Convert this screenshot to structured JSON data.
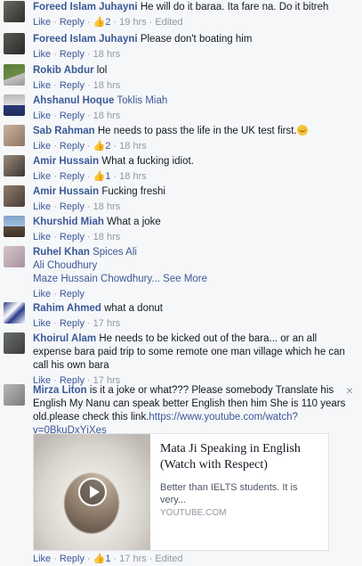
{
  "actions": {
    "like": "Like",
    "reply": "Reply",
    "edited": "Edited",
    "see_more": "See More",
    "thumb": "👍"
  },
  "comments": [
    {
      "name": "Foreed Islam Juhayni",
      "text": "He will do it baraa. Ita fare na. Do it bitreh",
      "likes": "2",
      "time": "19 hrs",
      "edited": true
    },
    {
      "name": "Foreed Islam Juhayni",
      "text": "Please don't boating him",
      "time": "18 hrs"
    },
    {
      "name": "Rokib Abdur",
      "text": "lol",
      "time": "18 hrs"
    },
    {
      "name": "Ahshanul Hoque",
      "text": "Toklis Miah",
      "time": "18 hrs",
      "text_is_link": true
    },
    {
      "name": "Sab Rahman",
      "text": "He needs to pass the life in the UK test first.",
      "likes": "2",
      "time": "18 hrs",
      "emoji": true
    },
    {
      "name": "Amir Hussain",
      "text": "What a fucking idiot.",
      "likes": "1",
      "time": "18 hrs"
    },
    {
      "name": "Amir Hussain",
      "text": "Fucking freshi",
      "time": "18 hrs"
    },
    {
      "name": "Khurshid Miah",
      "text": "What a joke",
      "time": "18 hrs"
    },
    {
      "name": "Ruhel Khan",
      "text": "Spices Ali",
      "text_is_link": true,
      "line2": "Ali Choudhury",
      "line3": "Maze Hussain Chowdhury...",
      "time": ""
    },
    {
      "name": "Rahim Ahmed",
      "text": "what a donut",
      "time": "17 hrs"
    },
    {
      "name": "Khoirul Alam",
      "text": "He needs to be kicked out of the bara... or an all expense bara paid trip to some remote one man village which he can call his own bara",
      "time": "17 hrs"
    },
    {
      "name": "Mirza Liton",
      "text": "is it a joke or what??? Please somebody Translate his English My Nanu can speak better English then him She is 110 years old.please check this link.",
      "link": "https://www.youtube.com/watch?v=0BkuDxYjXes",
      "likes": "1",
      "time": "17 hrs",
      "edited": true
    }
  ],
  "preview": {
    "title": "Mata Ji Speaking in English (Watch with Respect)",
    "description": "Better than IELTS students. It is very...",
    "source": "YOUTUBE.COM"
  },
  "close_glyph": "×"
}
